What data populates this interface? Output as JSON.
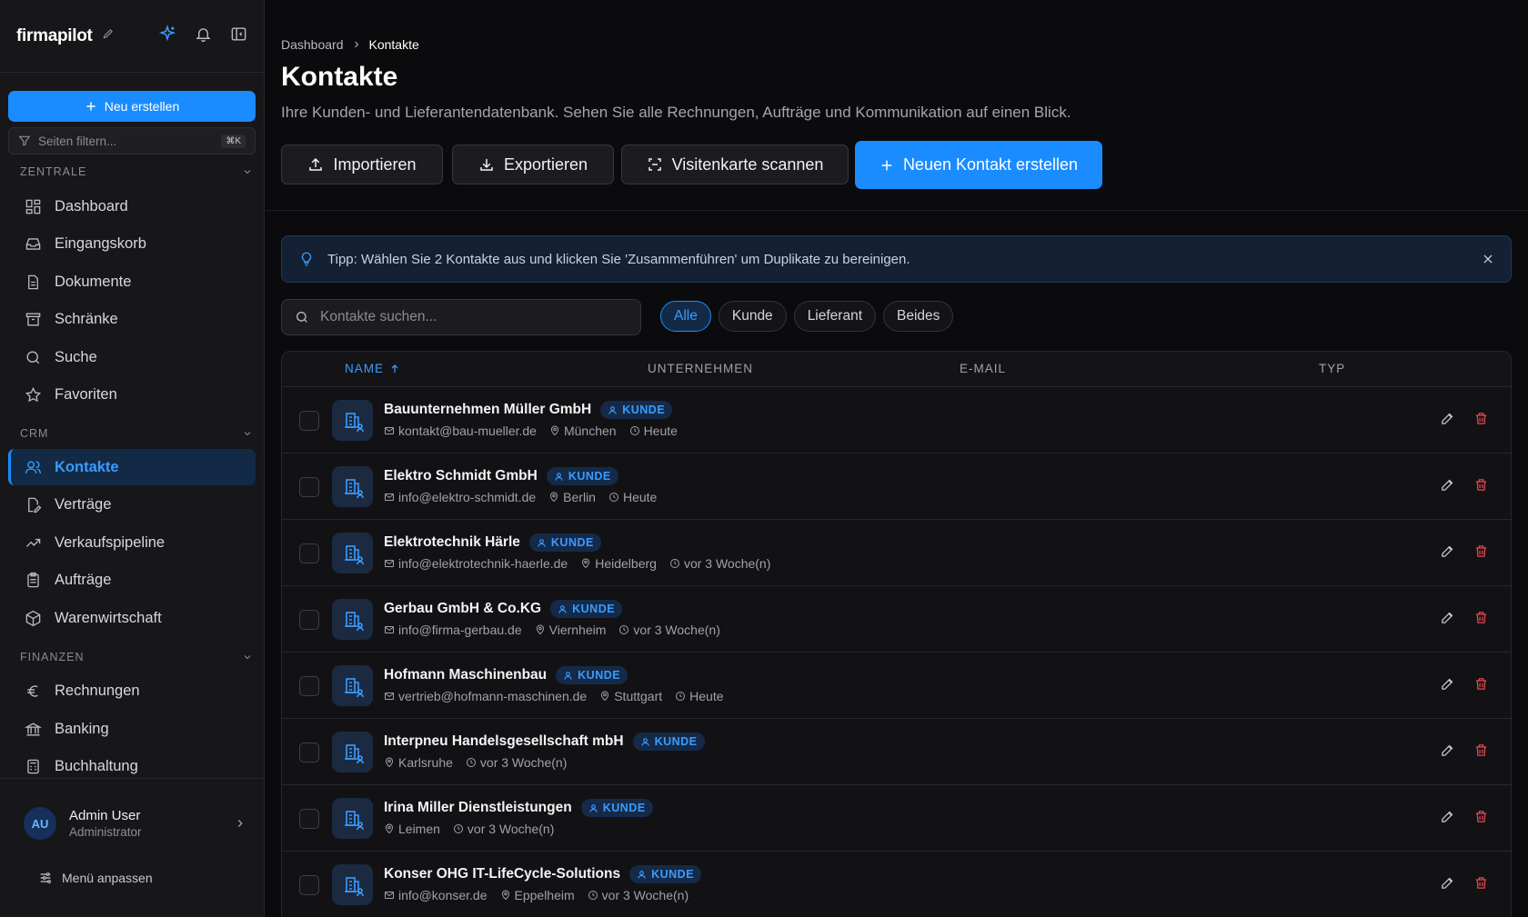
{
  "app": {
    "logo": "firmapilot",
    "new_button": "Neu erstellen",
    "filter_placeholder": "Seiten filtern...",
    "filter_shortcut": "⌘K",
    "accent": "#1a8cff",
    "danger": "#e5484d"
  },
  "sidebar": {
    "sections": [
      {
        "label": "ZENTRALE",
        "items": [
          "Dashboard",
          "Eingangskorb",
          "Dokumente",
          "Schränke",
          "Suche",
          "Favoriten"
        ]
      },
      {
        "label": "CRM",
        "items": [
          "Kontakte",
          "Verträge",
          "Verkaufspipeline",
          "Aufträge",
          "Warenwirtschaft"
        ]
      },
      {
        "label": "FINANZEN",
        "items": [
          "Rechnungen",
          "Banking",
          "Buchhaltung"
        ]
      }
    ],
    "user": {
      "initials": "AU",
      "name": "Admin User",
      "role": "Administrator"
    },
    "customize": "Menü anpassen"
  },
  "header": {
    "breadcrumb": [
      "Dashboard",
      "Kontakte"
    ],
    "title": "Kontakte",
    "subtitle": "Ihre Kunden- und Lieferantendatenbank. Sehen Sie alle Rechnungen, Aufträge und Kommunikation auf einen Blick.",
    "actions": [
      "Importieren",
      "Exportieren",
      "Visitenkarte scannen",
      "Neuen Kontakt erstellen"
    ]
  },
  "tip": "Tipp: Wählen Sie 2 Kontakte aus und klicken Sie 'Zusammenführen' um Duplikate zu bereinigen.",
  "search": {
    "placeholder": "Kontakte suchen..."
  },
  "filters": {
    "options": [
      "Alle",
      "Kunde",
      "Lieferant",
      "Beides"
    ],
    "active": "Alle"
  },
  "table": {
    "columns": [
      "NAME",
      "UNTERNEHMEN",
      "E-MAIL",
      "TYP"
    ],
    "rows": [
      {
        "name": "Bauunternehmen Müller GmbH",
        "type": "KUNDE",
        "email": "kontakt@bau-mueller.de",
        "city": "München",
        "time": "Heute"
      },
      {
        "name": "Elektro Schmidt GmbH",
        "type": "KUNDE",
        "email": "info@elektro-schmidt.de",
        "city": "Berlin",
        "time": "Heute"
      },
      {
        "name": "Elektrotechnik Härle",
        "type": "KUNDE",
        "email": "info@elektrotechnik-haerle.de",
        "city": "Heidelberg",
        "time": "vor 3 Woche(n)"
      },
      {
        "name": "Gerbau GmbH & Co.KG",
        "type": "KUNDE",
        "email": "info@firma-gerbau.de",
        "city": "Viernheim",
        "time": "vor 3 Woche(n)"
      },
      {
        "name": "Hofmann Maschinenbau",
        "type": "KUNDE",
        "email": "vertrieb@hofmann-maschinen.de",
        "city": "Stuttgart",
        "time": "Heute"
      },
      {
        "name": "Interpneu Handelsgesellschaft mbH",
        "type": "KUNDE",
        "email": "",
        "city": "Karlsruhe",
        "time": "vor 3 Woche(n)"
      },
      {
        "name": "Irina Miller Dienstleistungen",
        "type": "KUNDE",
        "email": "",
        "city": "Leimen",
        "time": "vor 3 Woche(n)"
      },
      {
        "name": "Konser OHG IT-LifeCycle-Solutions",
        "type": "KUNDE",
        "email": "info@konser.de",
        "city": "Eppelheim",
        "time": "vor 3 Woche(n)"
      }
    ]
  }
}
